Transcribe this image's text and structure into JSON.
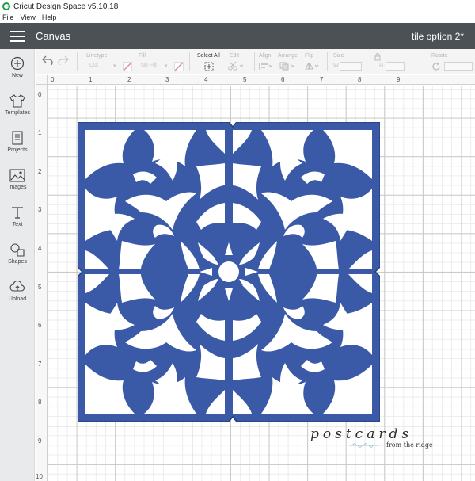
{
  "titlebar": {
    "title": "Cricut Design Space  v5.10.18"
  },
  "menu": [
    "File",
    "View",
    "Help"
  ],
  "header": {
    "section": "Canvas",
    "project_name": "tile option 2*"
  },
  "sidebar": [
    {
      "label": "New",
      "icon": "plus-circle-icon"
    },
    {
      "label": "Templates",
      "icon": "shirt-icon"
    },
    {
      "label": "Projects",
      "icon": "projects-icon"
    },
    {
      "label": "Images",
      "icon": "image-icon"
    },
    {
      "label": "Text",
      "icon": "text-icon"
    },
    {
      "label": "Shapes",
      "icon": "shapes-icon"
    },
    {
      "label": "Upload",
      "icon": "upload-icon"
    }
  ],
  "toolbar": {
    "linetype_label": "Linetype",
    "linetype_value": "Cut",
    "fill_label": "Fill",
    "fill_value": "No Fill",
    "select_all_label": "Select All",
    "edit_label": "Edit",
    "align_label": "Align",
    "arrange_label": "Arrange",
    "flip_label": "Flip",
    "size_label": "Size",
    "size_w": "W",
    "size_h": "H",
    "rotate_label": "Rotate"
  },
  "ruler": {
    "top": [
      "0",
      "1",
      "2",
      "3",
      "4",
      "5",
      "6",
      "7",
      "8",
      "9"
    ],
    "left": [
      "0",
      "1",
      "2",
      "3",
      "4",
      "5",
      "6",
      "7",
      "8",
      "9",
      "10"
    ]
  },
  "watermark": {
    "script": "postcards",
    "tagline": "from the ridge"
  },
  "colors": {
    "header": "#4b5155",
    "tile": "#3a5aa8",
    "sidebar": "#e9eaeb"
  }
}
